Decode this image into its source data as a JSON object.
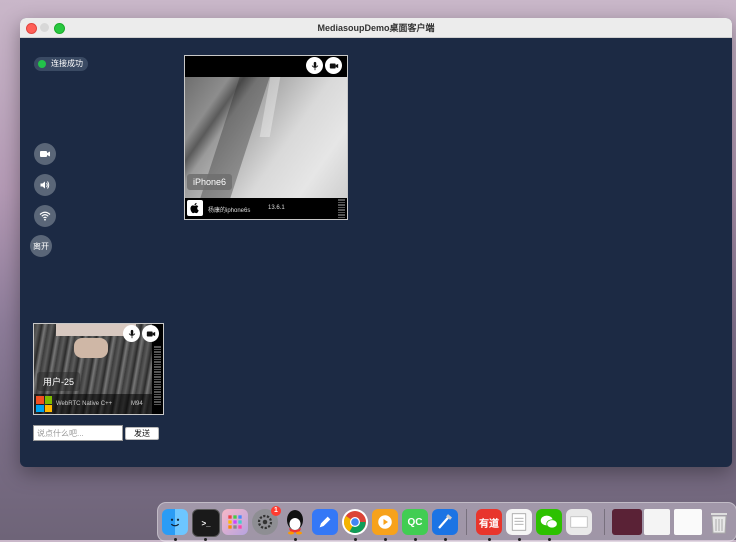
{
  "window": {
    "title": "MediasoupDemo桌面客户端"
  },
  "status": {
    "label": "连接成功",
    "color": "#22c24a"
  },
  "controls": {
    "camera_icon": "camera-icon",
    "speaker_icon": "speaker-icon",
    "wifi_icon": "wifi-icon",
    "leave_label": "离开"
  },
  "remote_peer": {
    "display_name": "iPhone6",
    "device_name": "杨康的iphone6s",
    "os_version": "13.6.1",
    "os_icon": "apple-logo-icon"
  },
  "local_peer": {
    "display_name": "用户-25",
    "client_name": "WebRTC Native C++",
    "version": "M94",
    "os_icon": "windows-logo-icon"
  },
  "chat": {
    "placeholder": "说点什么吧...",
    "send_label": "发送"
  },
  "dock": {
    "finder_badge": "",
    "settings_badge": "1",
    "youdao_label": "有道",
    "qc_label": "QC"
  }
}
